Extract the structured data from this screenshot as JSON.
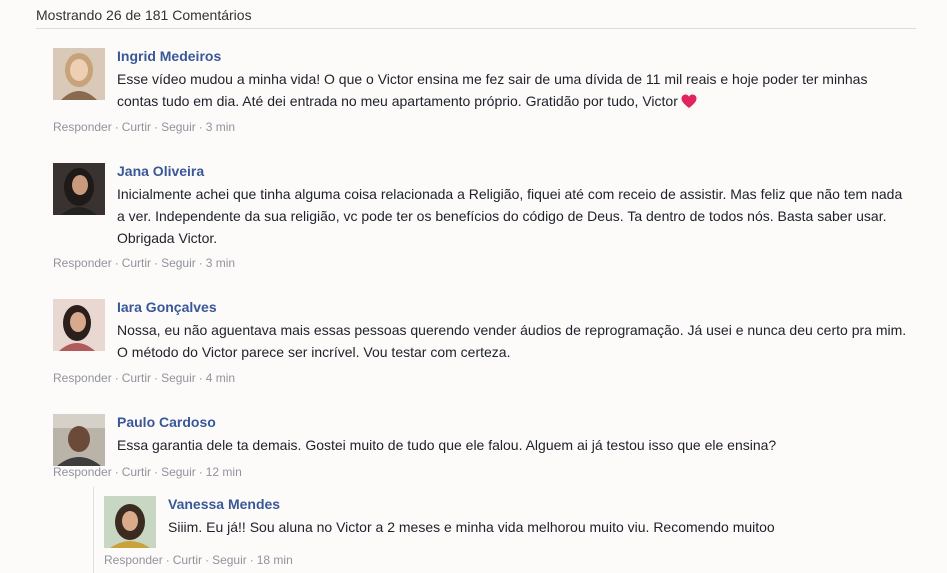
{
  "header": {
    "count_text": "Mostrando 26 de 181 Comentários"
  },
  "colors": {
    "name": "#385898",
    "meta": "#90949c",
    "heart": "#e0245e"
  },
  "comments": [
    {
      "author": "Ingrid Medeiros",
      "text": "Esse vídeo mudou a minha vida! O que o Victor ensina me fez sair de uma dívida de 11 mil reais e hoje poder ter minhas contas tudo em dia. Até dei entrada no meu apartamento próprio. Gratidão por tudo, Victor",
      "emoji": "heart-icon",
      "actions": {
        "reply": "Responder",
        "like": "Curtir",
        "follow": "Seguir",
        "time": "3 min"
      }
    },
    {
      "author": "Jana Oliveira",
      "text": "Inicialmente achei que tinha alguma coisa relacionada a Religião, fiquei até com receio de assistir. Mas feliz que não tem nada a ver. Independente da sua religião, vc pode ter os benefícios do código de Deus. Ta dentro de todos nós. Basta saber usar. Obrigada Victor.",
      "actions": {
        "reply": "Responder",
        "like": "Curtir",
        "follow": "Seguir",
        "time": "3 min"
      }
    },
    {
      "author": "Iara Gonçalves",
      "text": "Nossa, eu não aguentava mais essas pessoas querendo vender áudios de reprogramação. Já usei e nunca deu certo pra mim. O método do Victor parece ser incrível. Vou testar com certeza.",
      "actions": {
        "reply": "Responder",
        "like": "Curtir",
        "follow": "Seguir",
        "time": "4 min"
      }
    },
    {
      "author": "Paulo Cardoso",
      "text": "Essa garantia dele ta demais. Gostei muito de tudo que ele falou. Alguem ai já testou isso que ele ensina?",
      "actions": {
        "reply": "Responder",
        "like": "Curtir",
        "follow": "Seguir",
        "time": "12 min"
      }
    },
    {
      "author": "Vanessa Mendes",
      "text": "Siiim. Eu já!! Sou aluna no Victor a 2 meses e minha vida melhorou muito viu. Recomendo muitoo",
      "actions": {
        "reply": "Responder",
        "like": "Curtir",
        "follow": "Seguir",
        "time": "18 min"
      }
    }
  ]
}
